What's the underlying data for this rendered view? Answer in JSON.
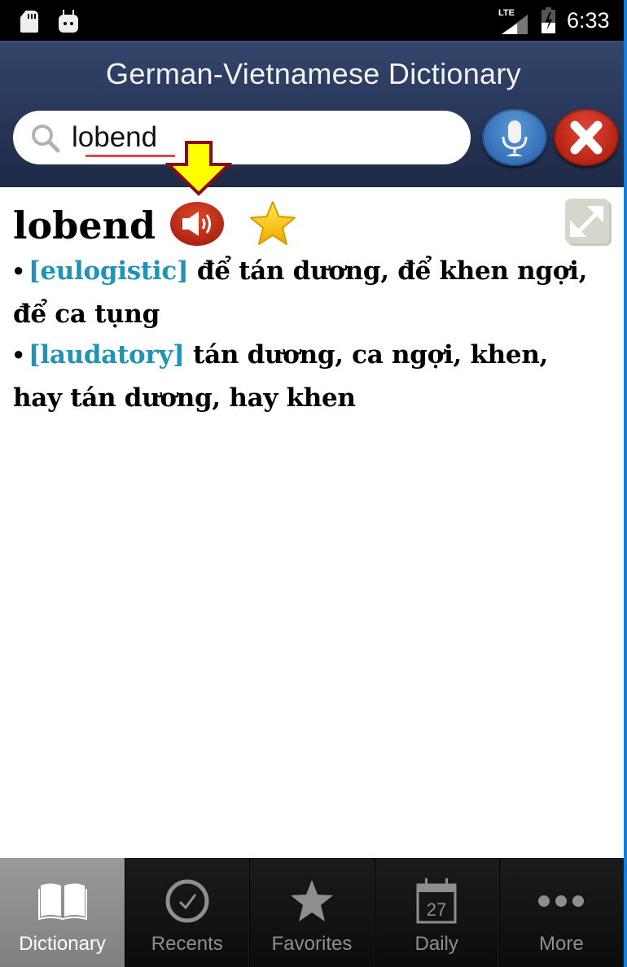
{
  "status_bar": {
    "network": "LTE",
    "time": "6:33",
    "icons": [
      "sd-card-icon",
      "android-debug-icon",
      "lte-signal-icon",
      "battery-charging-icon"
    ]
  },
  "header": {
    "title": "German-Vietnamese Dictionary",
    "search": {
      "value": "lobend",
      "placeholder": ""
    },
    "mic_button_icon": "microphone-icon",
    "clear_button_icon": "close-x-icon"
  },
  "entry": {
    "word": "lobend",
    "definitions": [
      {
        "pos": "[eulogistic]",
        "meaning": "để tán dương, để khen ngợi, để ca tụng"
      },
      {
        "pos": "[laudatory]",
        "meaning": "tán dương, ca ngợi, khen, hay tán dương, hay khen"
      }
    ]
  },
  "tabs": [
    {
      "label": "Dictionary",
      "icon": "book-icon",
      "active": true
    },
    {
      "label": "Recents",
      "icon": "clock-check-icon",
      "active": false
    },
    {
      "label": "Favorites",
      "icon": "star-icon",
      "active": false
    },
    {
      "label": "Daily",
      "icon": "calendar-icon",
      "active": false,
      "calendar_day": "27"
    },
    {
      "label": "More",
      "icon": "more-dots-icon",
      "active": false
    }
  ],
  "colors": {
    "header_bg": "#2a3a5e",
    "pos_label": "#2193b5",
    "mic_button": "#3a78c0",
    "clear_button": "#c8301f",
    "speaker_button": "#c0301c",
    "annotation_arrow_fill": "#ffff00",
    "annotation_arrow_stroke": "#8b0a0a"
  }
}
